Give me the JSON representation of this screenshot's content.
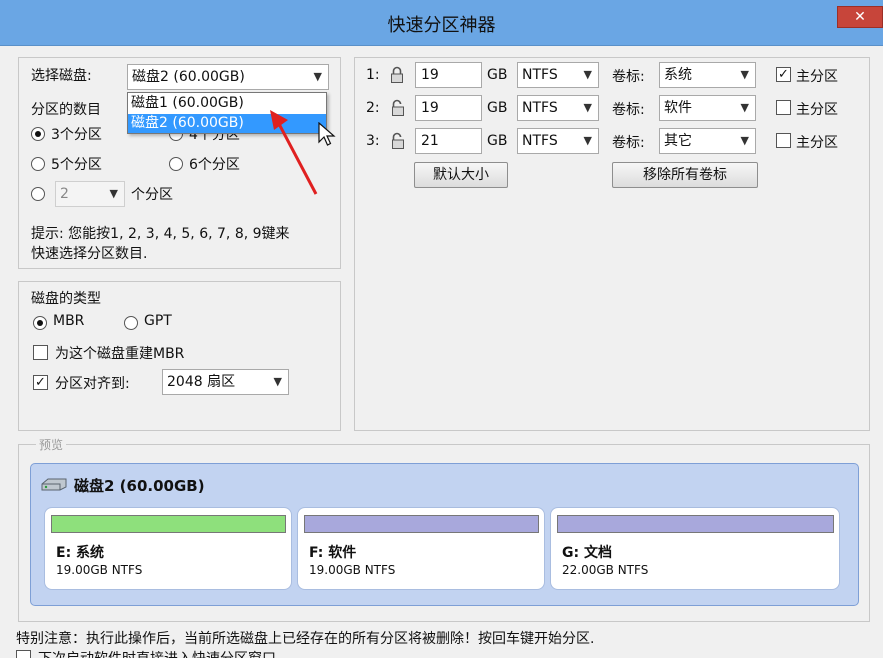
{
  "window": {
    "title": "快速分区神器",
    "close_glyph": "✕"
  },
  "disk_select": {
    "label": "选择磁盘:",
    "selected": "磁盘2 (60.00GB)",
    "options": [
      "磁盘1 (60.00GB)",
      "磁盘2 (60.00GB)"
    ]
  },
  "partition_count": {
    "title": "分区的数目",
    "opt3": "3个分区",
    "opt4": "4个分区",
    "opt5": "5个分区",
    "opt6": "6个分区",
    "custom_value": "2",
    "custom_suffix": "个分区",
    "hint_line1": "提示: 您能按1, 2, 3, 4, 5, 6, 7, 8, 9键来",
    "hint_line2": "快速选择分区数目."
  },
  "disk_type": {
    "title": "磁盘的类型",
    "mbr": "MBR",
    "gpt": "GPT",
    "rebuild_mbr": "为这个磁盘重建MBR",
    "align_label": "分区对齐到:",
    "align_value": "2048 扇区"
  },
  "partitions": [
    {
      "index": "1:",
      "size": "19",
      "unit": "GB",
      "fs": "NTFS",
      "vol_label": "卷标:",
      "volume": "系统",
      "primary_label": "主分区",
      "primary_checked": true
    },
    {
      "index": "2:",
      "size": "19",
      "unit": "GB",
      "fs": "NTFS",
      "vol_label": "卷标:",
      "volume": "软件",
      "primary_label": "主分区",
      "primary_checked": false
    },
    {
      "index": "3:",
      "size": "21",
      "unit": "GB",
      "fs": "NTFS",
      "vol_label": "卷标:",
      "volume": "其它",
      "primary_label": "主分区",
      "primary_checked": false
    }
  ],
  "buttons": {
    "default_size": "默认大小",
    "remove_labels": "移除所有卷标"
  },
  "preview": {
    "group_label": "预览",
    "disk_title": "磁盘2 (60.00GB)",
    "cards": [
      {
        "name": "E: 系统",
        "info": "19.00GB NTFS",
        "color": "#8ee07c"
      },
      {
        "name": "F: 软件",
        "info": "19.00GB NTFS",
        "color": "#a8a8dc"
      },
      {
        "name": "G: 文档",
        "info": "22.00GB NTFS",
        "color": "#a8a8dc"
      }
    ]
  },
  "footer": {
    "warning": "特别注意：执行此操作后，当前所选磁盘上已经存在的所有分区将被删除！按回车键开始分区.",
    "checkbox_text": "下次启动软件时直接进入快速分区窗口"
  },
  "colors": {
    "titlebar": "#6aa6e4",
    "selection": "#3399ff",
    "preview_bg": "#c2d3f1",
    "annotation_arrow": "#e02020"
  },
  "icons": [
    "lock-icon",
    "unlock-icon",
    "disk-drive-icon",
    "close-icon",
    "chevron-down-icon"
  ]
}
